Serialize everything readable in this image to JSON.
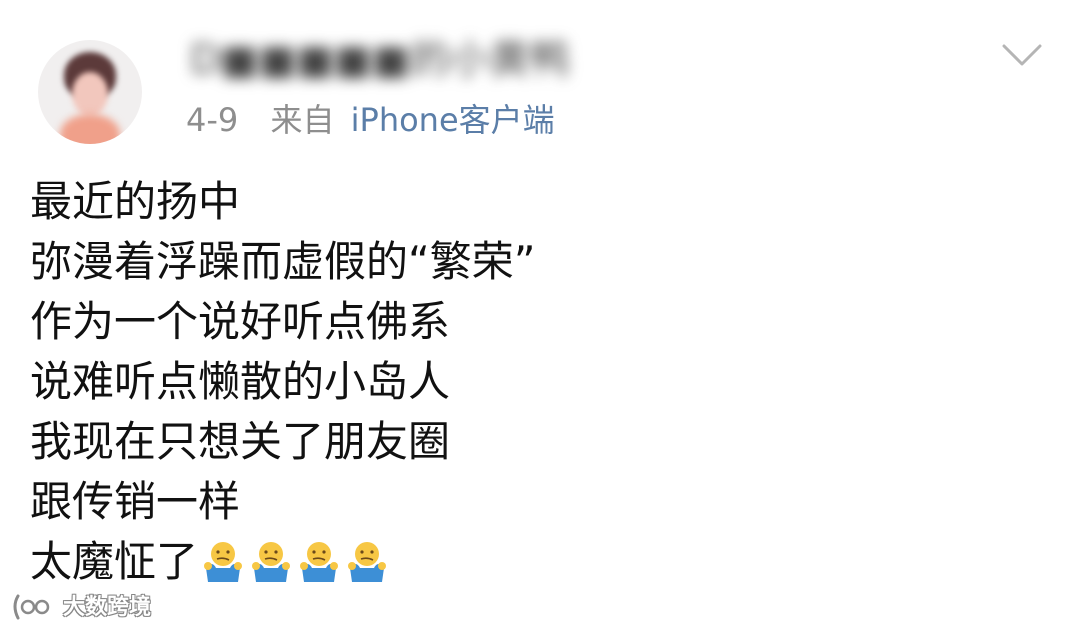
{
  "post": {
    "username": "D■■■■■的小黄鸭",
    "date": "4-9",
    "from_label": "来自",
    "source": "iPhone客户端",
    "expand_icon": "chevron-down-icon",
    "lines": [
      "最近的扬中",
      "弥漫着浮躁而虚假的“繁荣”",
      "作为一个说好听点佛系",
      "说难听点懒散的小岛人",
      "我现在只想关了朋友圈",
      "跟传销一样",
      "太魔怔了"
    ],
    "trailing_emoji": [
      "shrug-emoji",
      "shrug-emoji",
      "shrug-emoji",
      "shrug-emoji"
    ]
  },
  "colors": {
    "meta_gray": "#8e8e8e",
    "source_blue": "#5b7ea8",
    "text": "#111111",
    "emoji_yellow": "#f7c744",
    "emoji_blue": "#3d8fd6"
  },
  "watermark": {
    "text": "大数跨境"
  }
}
